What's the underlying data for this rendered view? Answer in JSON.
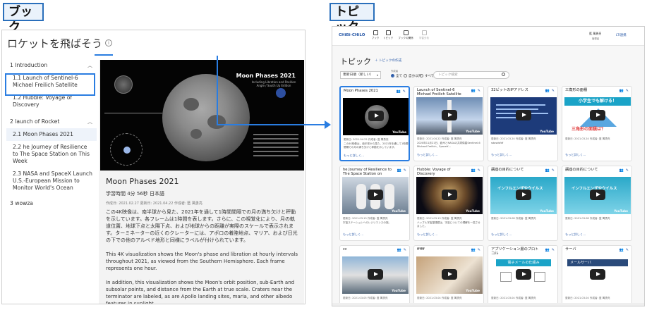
{
  "labels": {
    "book": "ブック",
    "topic": "トピック"
  },
  "book": {
    "title": "ロケットを飛ばそう",
    "info_icon": "i",
    "toc": [
      {
        "label": "1 Introduction"
      },
      {
        "label": "1.1 Launch of Sentinel-6 Michael Freilich Satellite"
      },
      {
        "label": "1.2 Hubble: Voyage of Discovery"
      },
      {
        "label": "2 launch of Rocket"
      },
      {
        "label": "2.1 Moon Phases 2021"
      },
      {
        "label": "2.2 he Journey of Resilience to The Space Station on This Week"
      },
      {
        "label": "2.3 NASA and SpaceX Launch U.S.-European Mission to Monitor World's Ocean"
      },
      {
        "label": "3 wowza"
      }
    ],
    "video": {
      "title": "Moon Phases 2021",
      "subtitle": "Including Libration and Position Angle / South Up Edition"
    },
    "content_title": "Moon Phases 2021",
    "meta": "学習時間 4分 56秒  日本語",
    "dates": "作成日: 2021.02.27   更新日: 2021.04.22   作成者: 藍 萬勇亮",
    "desc_ja": "この4K映像は、南半球から見た、2021年を通して1時間間隔での月の満ち欠けと秤動を示しています。各フレームは1時間を表します。さらに、この視覚化により、月の軌道位置、地球下点と太陽下点、および地球からの距離が実際のスケールで表示されます。ターミネーターの近くのクレーターには、アポロの着陸地点、マリア、および日光の下での他のアルベド地形と同様にラベルが付けられています。",
    "desc_en1": "This 4K visualization shows the Moon's phase and libration at hourly intervals throughout 2021, as viewed from the Southern Hemisphere. Each frame represents one hour.",
    "desc_en2": "In addition, this visualization shows the Moon's orbit position, sub-Earth and subsolar points, and distance from the Earth at true scale. Craters near the terminator are labeled, as are Apollo landing sites, maria, and other albedo features in sunlight."
  },
  "topic": {
    "brand": "CHiBi-CHiLO",
    "nav": [
      "ブック",
      "トピック",
      "ブックの関係",
      "学習分析"
    ],
    "user_name": "藍 萬勇亮",
    "user_role": "管理者",
    "lti_link": "LTI連携",
    "title": "トピック",
    "add": "トピックの作成",
    "sort": "更新日順（新しい）",
    "filter_label": "作成者",
    "filters": [
      "全て",
      "自分以外",
      "すべて"
    ],
    "search_placeholder": "トピック検索",
    "more": "もっと詳しく...",
    "youtube": "YouTube",
    "cards": [
      {
        "title": "Moon Phases 2021",
        "meta": "更新日: 2021.04.22  作成者: 藍 萬勇亮",
        "desc": "この4K映像は、南半球から見た、2021年を通して1時間間隔での月の満ち欠けと秤動を示しています。",
        "thumb": "moon"
      },
      {
        "title": "Launch of Sentinel-6 Michael Freilich Satellite",
        "meta": "更新日: 2021.04.22  作成者: 藍 萬勇亮",
        "desc": "2020年11月21日、欧州とNASAの共同衛星Sentinel-6 Michael Freilich、SpaceX...",
        "thumb": "rocket"
      },
      {
        "title": "32ビットのIPアドレス",
        "meta": "更新日: 2021.03.24  作成者: 藍 萬勇亮",
        "desc": "sdasdsfdf",
        "thumb": "slide"
      },
      {
        "title": "三角形の面積",
        "meta": "更新日: 2021.03.24  作成者: 藍 萬勇亮",
        "desc": "",
        "thumb": "tri"
      },
      {
        "title": "he Journey of Resilience to The Space Station on This...",
        "meta": "更新日: 2021.03.13  作成者: 藍 萬勇亮",
        "desc": "宇宙ステーションへのレジリエンスの旅。",
        "thumb": "astro"
      },
      {
        "title": "Hubble: Voyage of Discovery",
        "meta": "更新日: 2021.03.13  作成者: 藍 萬勇亮",
        "desc": "ハッブル宇宙望遠鏡は、宇宙についての理解を一変させました。",
        "thumb": "nebula"
      },
      {
        "title": "講座の目的について",
        "meta": "更新日: 2021.03.08  作成者: 藍 萬勇亮",
        "desc": "",
        "thumb": "inet"
      },
      {
        "title": "講座の目的について",
        "meta": "更新日: 2021.03.08  作成者: 藍 萬勇亮",
        "desc": "",
        "thumb": "inet"
      },
      {
        "title": "cc",
        "meta": "更新日: 2021.03.05  作成者: 藍 萬勇亮",
        "desc": "",
        "thumb": "photo1"
      },
      {
        "title": "ffffff",
        "meta": "更新日: 2021.03.04  作成者: 藍 萬勇亮",
        "desc": "",
        "thumb": "photo2"
      },
      {
        "title": "アプリケーション層のプロトコル",
        "meta": "更新日: 2021.03.04  作成者: 藍 萬勇亮",
        "desc": "",
        "thumb": "mail"
      },
      {
        "title": "サーバ",
        "meta": "更新日: 2021.03.04  作成者: 藍 萬勇亮",
        "desc": "",
        "thumb": "server"
      }
    ],
    "thumb_texts": {
      "tri_head": "小学生でも解ける！",
      "tri_foot": "三角形の面積は？",
      "inet": "インフルエンザやウイルス",
      "mail_head": "電子メールの仕組み",
      "server_head": "メールサーバ"
    }
  },
  "colors": {
    "accent": "#2a7de1",
    "brand": "#2a5aa8"
  }
}
